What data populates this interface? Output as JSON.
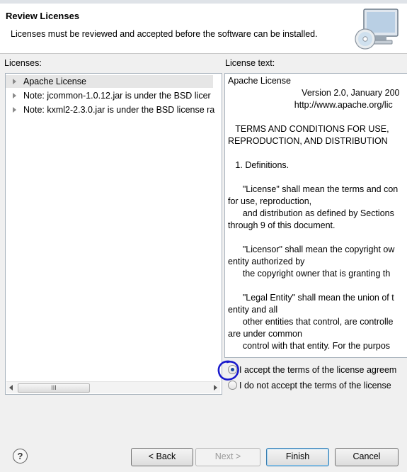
{
  "header": {
    "title": "Review Licenses",
    "description": "Licenses must be reviewed and accepted before the software can be installed.",
    "icon": "computer-cd-icon"
  },
  "licenses_panel": {
    "label": "Licenses:",
    "items": [
      {
        "label": "Apache License",
        "selected": true
      },
      {
        "label": "Note:  jcommon-1.0.12.jar is under the BSD licer"
      },
      {
        "label": "Note:  kxml2-2.3.0.jar is under the BSD license ra"
      }
    ],
    "scroll_thumb": "III"
  },
  "license_text_panel": {
    "label": "License text:",
    "lines": [
      "Apache License",
      "                              Version 2.0, January 200",
      "                           http://www.apache.org/lic",
      "",
      "   TERMS AND CONDITIONS FOR USE,",
      "REPRODUCTION, AND DISTRIBUTION",
      "",
      "   1. Definitions.",
      "",
      "      \"License\" shall mean the terms and con",
      "for use, reproduction,",
      "      and distribution as defined by Sections",
      "through 9 of this document.",
      "",
      "      \"Licensor\" shall mean the copyright ow",
      "entity authorized by",
      "      the copyright owner that is granting th",
      "",
      "      \"Legal Entity\" shall mean the union of t",
      "entity and all",
      "      other entities that control, are controlle",
      "are under common",
      "      control with that entity. For the purpos"
    ]
  },
  "acceptance": {
    "accept_label": "I accept the terms of the license agreem",
    "decline_label": "I do not accept the terms of the license",
    "selected": "accept"
  },
  "buttons": {
    "help": "?",
    "back": "< Back",
    "next": "Next >",
    "finish": "Finish",
    "cancel": "Cancel"
  },
  "colors": {
    "annotation": "#1a1acc",
    "header_bg": "#ffffff",
    "dialog_bg": "#f0f0f0"
  }
}
